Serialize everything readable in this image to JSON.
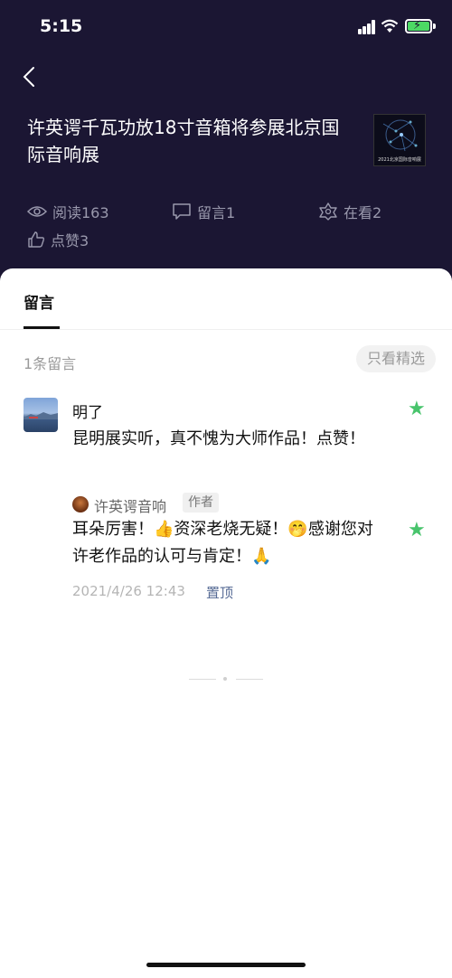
{
  "status_bar": {
    "time": "5:15"
  },
  "article": {
    "title": "许英谔千瓦功放18寸音箱将参展北京国际音响展",
    "cover_caption": "2021北京国际音响展"
  },
  "stats": {
    "reads": "阅读163",
    "comments": "留言1",
    "watching": "在看2",
    "likes": "点赞3"
  },
  "sheet": {
    "tab_label": "留言",
    "count_label": "1条留言",
    "filter_label": "只看精选"
  },
  "comment": {
    "username": "明了",
    "text": "昆明展实听，真不愧为大师作品！点赞！",
    "starred": true
  },
  "reply": {
    "name": "许英谔音响",
    "badge": "作者",
    "text": "耳朵厉害！👍资深老烧无疑！🤭感谢您对许老作品的认可与肯定！🙏",
    "starred": true
  },
  "meta": {
    "date": "2021/4/26 12:43",
    "pin_label": "置顶"
  },
  "colors": {
    "header_bg": "#1b1633",
    "star": "#48c46c",
    "link": "#576b95"
  }
}
